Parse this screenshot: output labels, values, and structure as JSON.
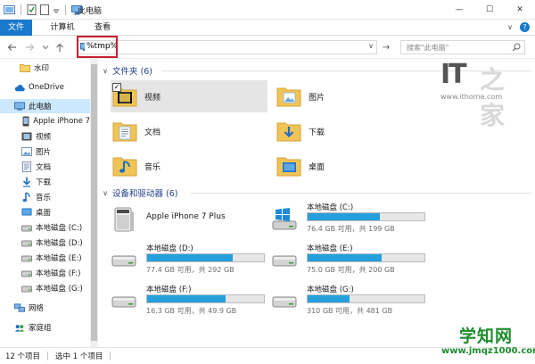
{
  "window": {
    "title": "此电脑",
    "min_label": "—",
    "max_label": "☐",
    "close_label": "✕"
  },
  "ribbon": {
    "tabs": [
      "文件",
      "计算机",
      "查看"
    ],
    "collapse_label": "∨",
    "help_label": "?"
  },
  "address": {
    "value": "%tmp%",
    "chevron": "∨",
    "go_label": "→"
  },
  "search": {
    "placeholder": "搜索\"此电脑\""
  },
  "sidebar": {
    "items": [
      {
        "label": "水印",
        "icon": "folder-icon"
      },
      {
        "label": "OneDrive",
        "icon": "cloud-icon"
      },
      {
        "label": "此电脑",
        "icon": "computer-icon"
      },
      {
        "label": "Apple iPhone 7",
        "icon": "phone-icon"
      },
      {
        "label": "视频",
        "icon": "video-icon"
      },
      {
        "label": "图片",
        "icon": "pictures-icon"
      },
      {
        "label": "文档",
        "icon": "documents-icon"
      },
      {
        "label": "下载",
        "icon": "download-icon"
      },
      {
        "label": "音乐",
        "icon": "music-icon"
      },
      {
        "label": "桌面",
        "icon": "desktop-icon"
      },
      {
        "label": "本地磁盘 (C:)",
        "icon": "drive-icon"
      },
      {
        "label": "本地磁盘 (D:)",
        "icon": "drive-icon"
      },
      {
        "label": "本地磁盘 (E:)",
        "icon": "drive-icon"
      },
      {
        "label": "本地磁盘 (F:)",
        "icon": "drive-icon"
      },
      {
        "label": "本地磁盘 (G:)",
        "icon": "drive-icon"
      },
      {
        "label": "网络",
        "icon": "network-icon"
      },
      {
        "label": "家庭组",
        "icon": "homegroup-icon"
      }
    ]
  },
  "folders": {
    "header": "文件夹 (6)",
    "items": [
      {
        "label": "视频",
        "icon": "video-folder-icon"
      },
      {
        "label": "图片",
        "icon": "pictures-folder-icon"
      },
      {
        "label": "文档",
        "icon": "documents-folder-icon"
      },
      {
        "label": "下载",
        "icon": "download-folder-icon"
      },
      {
        "label": "音乐",
        "icon": "music-folder-icon"
      },
      {
        "label": "桌面",
        "icon": "desktop-folder-icon"
      }
    ]
  },
  "devices": {
    "header": "设备和驱动器 (6)",
    "phone": {
      "label": "Apple iPhone 7 Plus"
    },
    "drives": [
      {
        "name": "本地磁盘 (C:)",
        "free": "76.4 GB 可用，共 199 GB",
        "used_fraction": 0.62,
        "system": true
      },
      {
        "name": "本地磁盘 (D:)",
        "free": "77.4 GB 可用，共 292 GB",
        "used_fraction": 0.73
      },
      {
        "name": "本地磁盘 (E:)",
        "free": "75.0 GB 可用，共 200 GB",
        "used_fraction": 0.63
      },
      {
        "name": "本地磁盘 (F:)",
        "free": "16.3 GB 可用，共 49.9 GB",
        "used_fraction": 0.67
      },
      {
        "name": "本地磁盘 (G:)",
        "free": "310 GB 可用，共 481 GB",
        "used_fraction": 0.36
      }
    ]
  },
  "status": {
    "count": "12 个项目",
    "selected": "选中 1 个项目"
  },
  "watermarks": {
    "ithome_logo": "IT",
    "ithome_logo2": "之家",
    "ithome_site": "www.ithome.com",
    "xuezhi_big": "学知网",
    "xuezhi_small": "www.jmqz1000.com"
  },
  "colors": {
    "accent": "#1979ca",
    "drive_bar": "#26a0da",
    "selection": "#cce8ff",
    "highlight_box": "#c8202f",
    "group_header": "#1f3f8a"
  }
}
